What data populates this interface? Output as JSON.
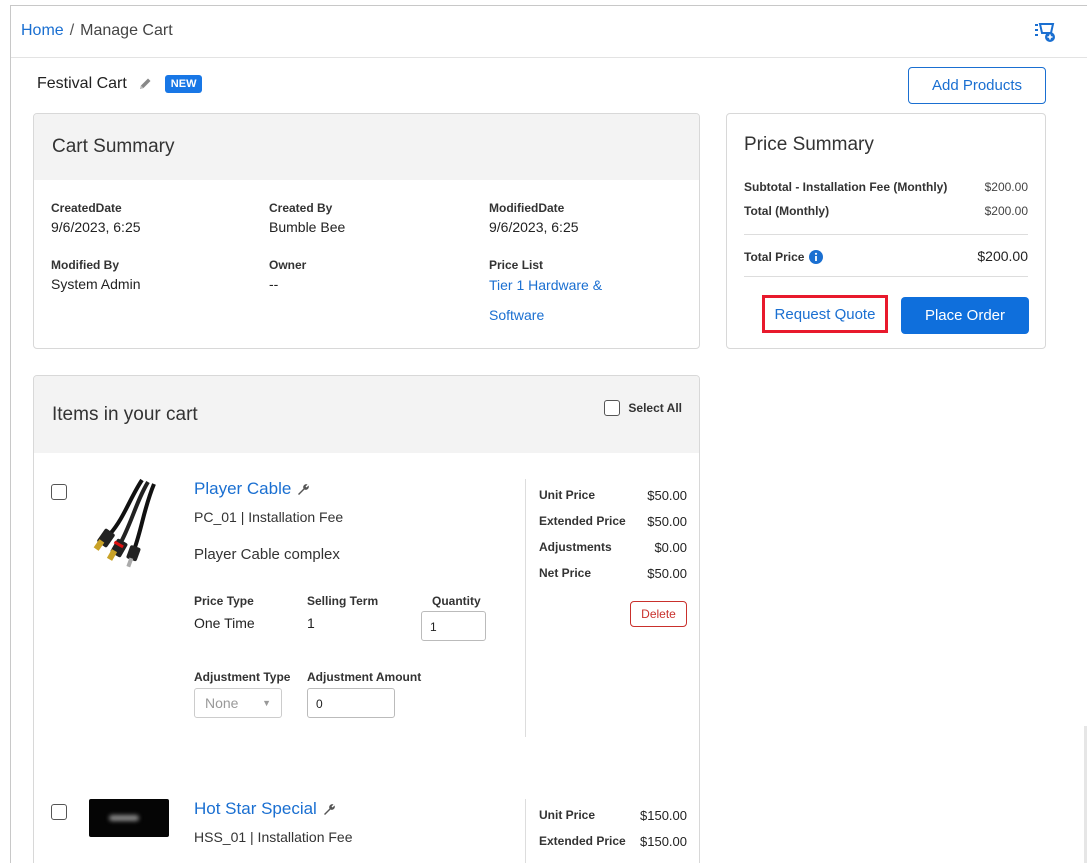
{
  "breadcrumb": {
    "home": "Home",
    "separator": "/",
    "current": "Manage Cart"
  },
  "cart": {
    "name": "Festival Cart",
    "status_badge": "NEW",
    "add_products_label": "Add Products"
  },
  "cart_summary": {
    "title": "Cart Summary",
    "created_date_label": "CreatedDate",
    "created_date": "9/6/2023, 6:25",
    "created_by_label": "Created By",
    "created_by": "Bumble Bee",
    "modified_date_label": "ModifiedDate",
    "modified_date": "9/6/2023, 6:25",
    "modified_by_label": "Modified By",
    "modified_by": "System Admin",
    "owner_label": "Owner",
    "owner": "--",
    "price_list_label": "Price List",
    "price_list_line1": "Tier 1 Hardware &",
    "price_list_line2": "Software"
  },
  "price_summary": {
    "title": "Price Summary",
    "subtotal_label": "Subtotal - Installation Fee (Monthly)",
    "subtotal": "$200.00",
    "total_monthly_label": "Total (Monthly)",
    "total_monthly": "$200.00",
    "total_price_label": "Total Price",
    "total_price": "$200.00",
    "request_quote_label": "Request Quote",
    "place_order_label": "Place Order"
  },
  "items_panel": {
    "title": "Items in your cart",
    "select_all_label": "Select All"
  },
  "items": [
    {
      "name": "Player Cable",
      "code_line": "PC_01 | Installation Fee",
      "description": "Player Cable complex",
      "price_type_label": "Price Type",
      "price_type": "One Time",
      "selling_term_label": "Selling Term",
      "selling_term": "1",
      "quantity_label": "Quantity",
      "quantity": "1",
      "adjustment_type_label": "Adjustment Type",
      "adjustment_type": "None",
      "adjustment_amount_label": "Adjustment Amount",
      "adjustment_amount": "0",
      "unit_price_label": "Unit Price",
      "unit_price": "$50.00",
      "extended_price_label": "Extended Price",
      "extended_price": "$50.00",
      "adjustments_label": "Adjustments",
      "adjustments": "$0.00",
      "net_price_label": "Net Price",
      "net_price": "$50.00",
      "delete_label": "Delete"
    },
    {
      "name": "Hot Star Special",
      "code_line": "HSS_01 | Installation Fee",
      "unit_price_label": "Unit Price",
      "unit_price": "$150.00",
      "extended_price_label": "Extended Price",
      "extended_price": "$150.00"
    }
  ],
  "colors": {
    "link": "#1a6fd1",
    "primary_button": "#0f6fdc",
    "highlight": "#e8192c",
    "delete": "#c9302c"
  }
}
